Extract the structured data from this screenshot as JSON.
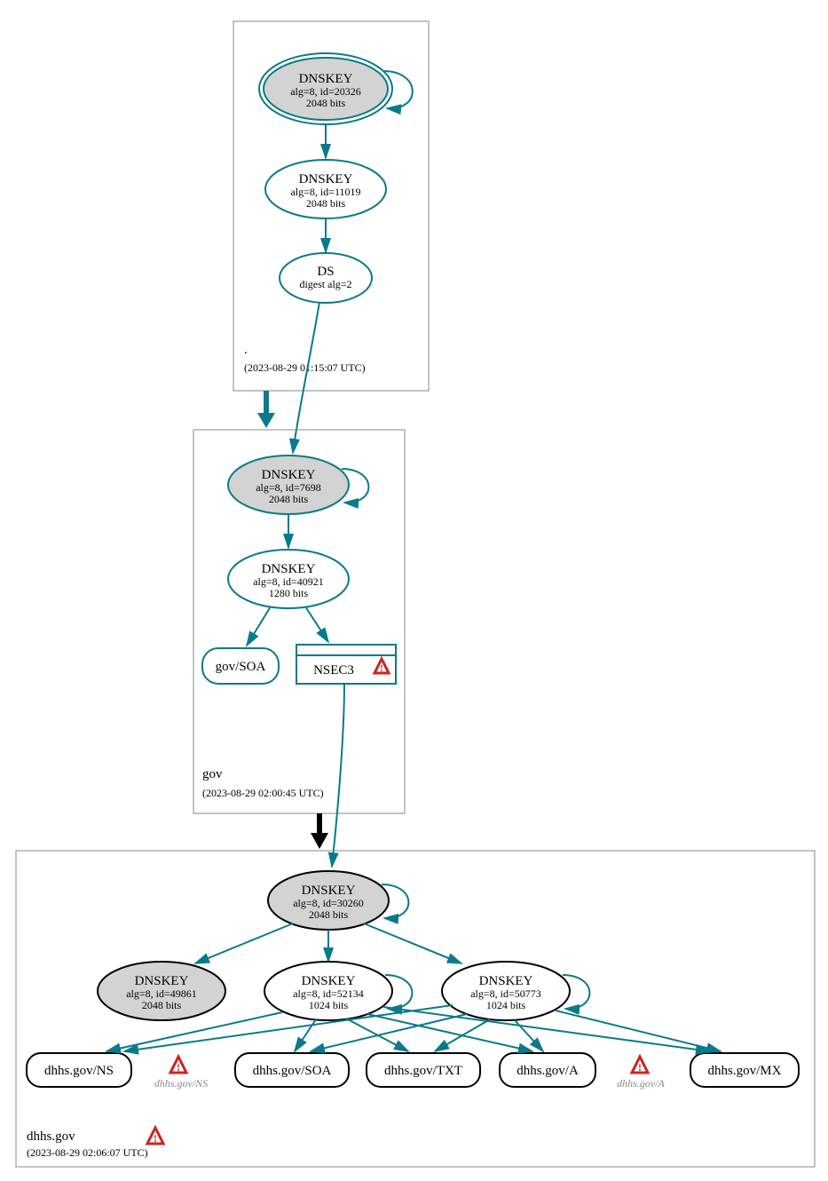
{
  "zones": {
    "root": {
      "label": ".",
      "timestamp": "(2023-08-29 01:15:07 UTC)"
    },
    "gov": {
      "label": "gov",
      "timestamp": "(2023-08-29 02:00:45 UTC)"
    },
    "dhhs": {
      "label": "dhhs.gov",
      "timestamp": "(2023-08-29 02:06:07 UTC)"
    }
  },
  "nodes": {
    "root_ksk": {
      "title": "DNSKEY",
      "line1": "alg=8, id=20326",
      "line2": "2048 bits"
    },
    "root_zsk": {
      "title": "DNSKEY",
      "line1": "alg=8, id=11019",
      "line2": "2048 bits"
    },
    "root_ds": {
      "title": "DS",
      "line1": "digest alg=2"
    },
    "gov_ksk": {
      "title": "DNSKEY",
      "line1": "alg=8, id=7698",
      "line2": "2048 bits"
    },
    "gov_zsk": {
      "title": "DNSKEY",
      "line1": "alg=8, id=40921",
      "line2": "1280 bits"
    },
    "gov_soa": {
      "title": "gov/SOA"
    },
    "gov_nsec3": {
      "title": "NSEC3"
    },
    "dhhs_ksk": {
      "title": "DNSKEY",
      "line1": "alg=8, id=30260",
      "line2": "2048 bits"
    },
    "dhhs_k49": {
      "title": "DNSKEY",
      "line1": "alg=8, id=49861",
      "line2": "2048 bits"
    },
    "dhhs_k52": {
      "title": "DNSKEY",
      "line1": "alg=8, id=52134",
      "line2": "1024 bits"
    },
    "dhhs_k50": {
      "title": "DNSKEY",
      "line1": "alg=8, id=50773",
      "line2": "1024 bits"
    },
    "dhhs_ns": {
      "title": "dhhs.gov/NS"
    },
    "dhhs_soa": {
      "title": "dhhs.gov/SOA"
    },
    "dhhs_txt": {
      "title": "dhhs.gov/TXT"
    },
    "dhhs_a": {
      "title": "dhhs.gov/A"
    },
    "dhhs_mx": {
      "title": "dhhs.gov/MX"
    },
    "warn_ns": {
      "label": "dhhs.gov/NS"
    },
    "warn_a": {
      "label": "dhhs.gov/A"
    }
  },
  "colors": {
    "teal": "#0a7a8a",
    "grey": "#d3d3d3",
    "warn_red": "#cc2222"
  }
}
